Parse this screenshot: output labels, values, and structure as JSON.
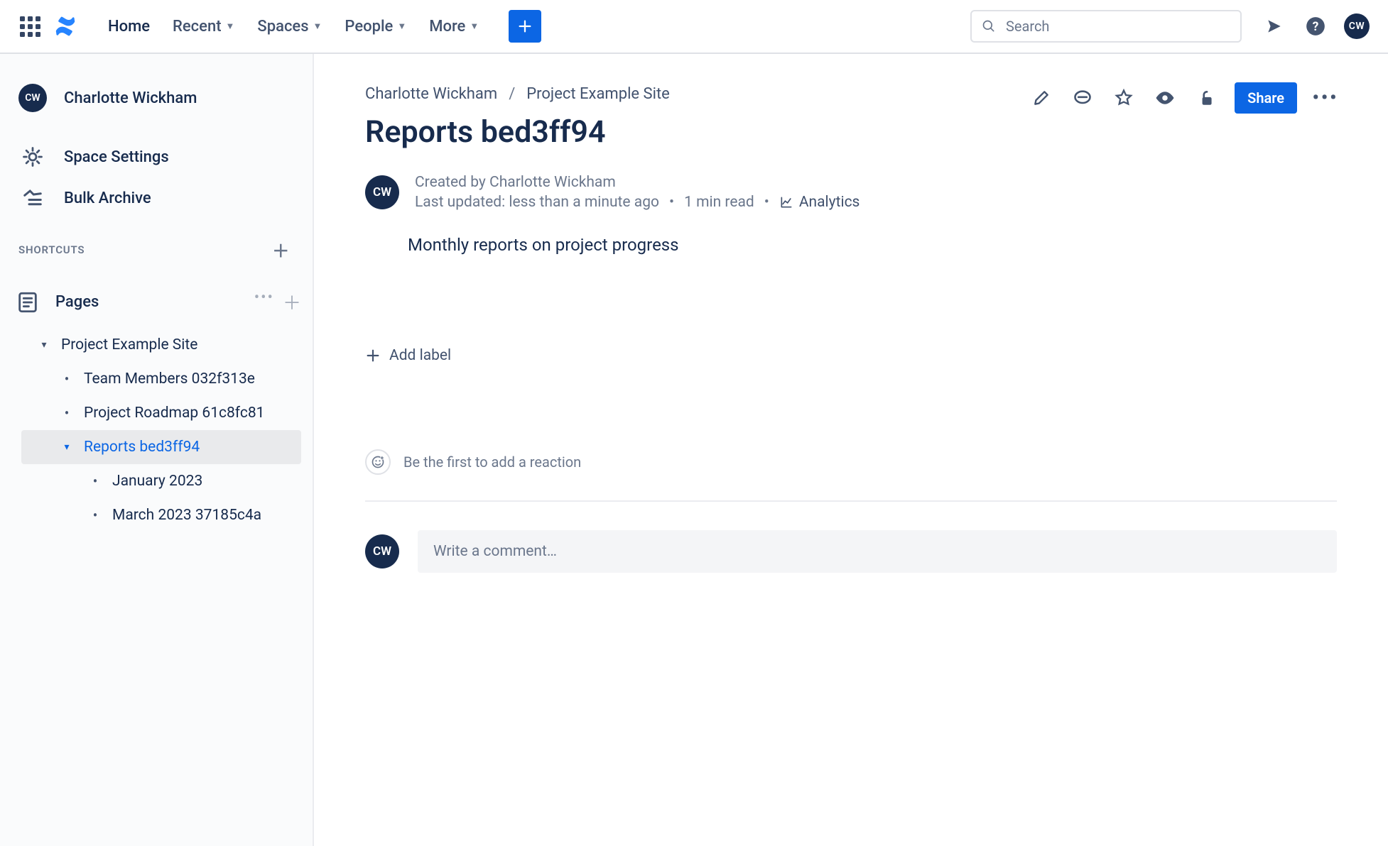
{
  "nav": {
    "home": "Home",
    "recent": "Recent",
    "spaces": "Spaces",
    "people": "People",
    "more": "More",
    "search_placeholder": "Search"
  },
  "avatar_initials": "CW",
  "sidebar": {
    "user_name": "Charlotte Wickham",
    "space_settings": "Space Settings",
    "bulk_archive": "Bulk Archive",
    "shortcuts_header": "SHORTCUTS",
    "pages_header": "Pages",
    "tree": {
      "root": "Project Example Site",
      "p1": "Team Members 032f313e",
      "p2": "Project Roadmap 61c8fc81",
      "p3": "Reports bed3ff94",
      "p3a": "January 2023",
      "p3b": "March 2023 37185c4a"
    }
  },
  "breadcrumb": {
    "space": "Charlotte Wickham",
    "parent": "Project Example Site"
  },
  "page": {
    "title": "Reports bed3ff94",
    "created_by": "Created by Charlotte Wickham",
    "updated": "Last updated: less than a minute ago",
    "read_time": "1 min read",
    "analytics_label": "Analytics",
    "body": "Monthly reports on project progress",
    "add_label": "Add label",
    "reaction_prompt": "Be the first to add a reaction",
    "comment_placeholder": "Write a comment…",
    "share": "Share"
  }
}
